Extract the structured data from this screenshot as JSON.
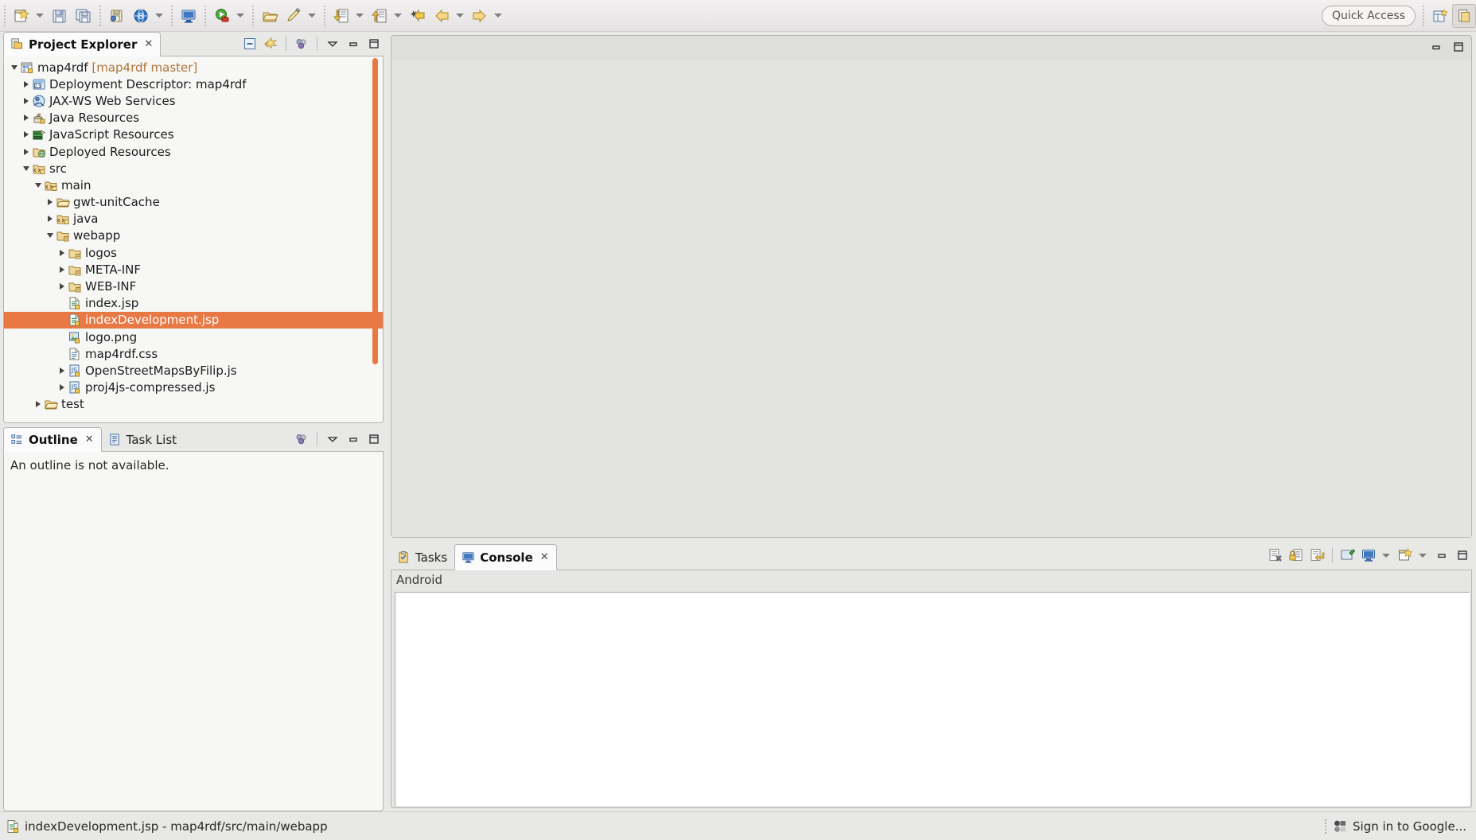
{
  "toolbar": {
    "items": [
      {
        "name": "new-wizard-button",
        "icon": "new-file-icon",
        "dropdown": true
      },
      {
        "name": "save-button",
        "icon": "save-icon",
        "dropdown": false
      },
      {
        "name": "save-all-button",
        "icon": "save-all-icon",
        "dropdown": false
      },
      {
        "name": "publish-button",
        "icon": "publish-icon",
        "dropdown": false
      },
      {
        "name": "open-browser-button",
        "icon": "globe-icon",
        "dropdown": true
      },
      {
        "name": "new-console-button",
        "icon": "console-icon",
        "dropdown": false
      },
      {
        "name": "run-button",
        "icon": "run-icon",
        "dropdown": true
      },
      {
        "name": "open-type-button",
        "icon": "open-package-icon",
        "dropdown": false
      },
      {
        "name": "search-button",
        "icon": "pencil-icon",
        "dropdown": true
      },
      {
        "name": "next-annotation-button",
        "icon": "next-annotation-icon",
        "dropdown": true
      },
      {
        "name": "previous-annotation-button",
        "icon": "previous-annotation-icon",
        "dropdown": true
      },
      {
        "name": "last-edit-location-button",
        "icon": "last-edit-icon",
        "dropdown": false
      },
      {
        "name": "back-button",
        "icon": "arrow-left-icon",
        "dropdown": true
      },
      {
        "name": "forward-button",
        "icon": "arrow-right-icon",
        "dropdown": true
      }
    ],
    "quick_access_label": "Quick Access",
    "perspective_java_ee": "open-perspective-icon",
    "perspective_current": "java-ee-perspective-icon"
  },
  "project_explorer": {
    "tab_label": "Project Explorer",
    "close_glyph": "✕",
    "tools": [
      {
        "name": "collapse-all-button",
        "icon": "collapse-all-icon"
      },
      {
        "name": "link-with-editor-button",
        "icon": "link-editor-icon"
      },
      {
        "name": "view-menu-button",
        "icon": "view-menu-icon"
      },
      {
        "name": "minimize-button",
        "icon": "minimize-icon"
      },
      {
        "name": "maximize-button",
        "icon": "maximize-icon"
      }
    ],
    "tree": [
      {
        "label": "map4rdf",
        "suffix": " [map4rdf master]",
        "indent": 0,
        "twisty": "down",
        "icon": "project-icon",
        "selected": false
      },
      {
        "label": "Deployment Descriptor: map4rdf",
        "suffix": "",
        "indent": 1,
        "twisty": "right",
        "icon": "deployment-descriptor-icon",
        "selected": false
      },
      {
        "label": "JAX-WS Web Services",
        "suffix": "",
        "indent": 1,
        "twisty": "right",
        "icon": "jaxws-icon",
        "selected": false
      },
      {
        "label": "Java Resources",
        "suffix": "",
        "indent": 1,
        "twisty": "right",
        "icon": "java-resources-icon",
        "selected": false
      },
      {
        "label": "JavaScript Resources",
        "suffix": "",
        "indent": 1,
        "twisty": "right",
        "icon": "javascript-resources-icon",
        "selected": false
      },
      {
        "label": "Deployed Resources",
        "suffix": "",
        "indent": 1,
        "twisty": "right",
        "icon": "deployed-resources-icon",
        "selected": false
      },
      {
        "label": "src",
        "suffix": "",
        "indent": 1,
        "twisty": "down",
        "icon": "source-folder-icon",
        "selected": false
      },
      {
        "label": "main",
        "suffix": "",
        "indent": 2,
        "twisty": "down",
        "icon": "source-folder-icon",
        "selected": false
      },
      {
        "label": "gwt-unitCache",
        "suffix": "",
        "indent": 3,
        "twisty": "right",
        "icon": "plain-folder-icon",
        "selected": false
      },
      {
        "label": "java",
        "suffix": "",
        "indent": 3,
        "twisty": "right",
        "icon": "source-folder-icon",
        "selected": false
      },
      {
        "label": "webapp",
        "suffix": "",
        "indent": 3,
        "twisty": "down",
        "icon": "web-folder-icon",
        "selected": false
      },
      {
        "label": "logos",
        "suffix": "",
        "indent": 4,
        "twisty": "right",
        "icon": "web-folder-icon",
        "selected": false
      },
      {
        "label": "META-INF",
        "suffix": "",
        "indent": 4,
        "twisty": "right",
        "icon": "web-folder-icon",
        "selected": false
      },
      {
        "label": "WEB-INF",
        "suffix": "",
        "indent": 4,
        "twisty": "right",
        "icon": "web-folder-icon",
        "selected": false
      },
      {
        "label": "index.jsp",
        "suffix": "",
        "indent": 4,
        "twisty": "none",
        "icon": "jsp-file-icon",
        "selected": false
      },
      {
        "label": "indexDevelopment.jsp",
        "suffix": "",
        "indent": 4,
        "twisty": "none",
        "icon": "jsp-file-icon",
        "selected": true
      },
      {
        "label": "logo.png",
        "suffix": "",
        "indent": 4,
        "twisty": "none",
        "icon": "image-file-icon",
        "selected": false
      },
      {
        "label": "map4rdf.css",
        "suffix": "",
        "indent": 4,
        "twisty": "none",
        "icon": "css-file-icon",
        "selected": false
      },
      {
        "label": "OpenStreetMapsByFilip.js",
        "suffix": "",
        "indent": 4,
        "twisty": "right",
        "icon": "js-file-icon",
        "selected": false
      },
      {
        "label": "proj4js-compressed.js",
        "suffix": "",
        "indent": 4,
        "twisty": "right",
        "icon": "js-file-icon",
        "selected": false
      },
      {
        "label": "test",
        "suffix": "",
        "indent": 2,
        "twisty": "right",
        "icon": "plain-folder-icon",
        "selected": false
      }
    ]
  },
  "outline": {
    "tabs": [
      {
        "label": "Outline",
        "icon": "outline-icon",
        "active": true,
        "closeable": true
      },
      {
        "label": "Task List",
        "icon": "task-list-icon",
        "active": false,
        "closeable": false
      }
    ],
    "close_glyph": "✕",
    "message": "An outline is not available.",
    "tools": [
      {
        "name": "view-menu-button",
        "icon": "view-menu-icon"
      },
      {
        "name": "minimize-button",
        "icon": "minimize-icon"
      },
      {
        "name": "maximize-button",
        "icon": "maximize-icon"
      }
    ]
  },
  "editor": {
    "tools": [
      {
        "name": "minimize-button",
        "icon": "minimize-icon"
      },
      {
        "name": "maximize-button",
        "icon": "maximize-icon"
      }
    ]
  },
  "console": {
    "tabs": [
      {
        "label": "Tasks",
        "icon": "tasks-icon",
        "active": false,
        "closeable": false
      },
      {
        "label": "Console",
        "icon": "console-icon",
        "active": true,
        "closeable": true
      }
    ],
    "close_glyph": "✕",
    "header_label": "Android",
    "output": "",
    "tools": [
      {
        "name": "clear-console-button",
        "icon": "clear-console-icon"
      },
      {
        "name": "scroll-lock-button",
        "icon": "scroll-lock-icon"
      },
      {
        "name": "word-wrap-button",
        "icon": "word-wrap-icon"
      },
      {
        "name": "pin-console-button",
        "icon": "pin-console-icon"
      },
      {
        "name": "display-selected-console-button",
        "icon": "display-console-icon",
        "dropdown": true
      },
      {
        "name": "open-console-button",
        "icon": "open-console-icon",
        "dropdown": true
      },
      {
        "name": "minimize-button",
        "icon": "minimize-icon"
      },
      {
        "name": "maximize-button",
        "icon": "maximize-icon"
      }
    ]
  },
  "statusbar": {
    "selection_icon": "jsp-file-icon",
    "selection_text": "indexDevelopment.jsp - map4rdf/src/main/webapp",
    "google_icon": "google-signin-icon",
    "google_label": "Sign in to Google..."
  },
  "colors": {
    "selection_orange": "#e87844",
    "project_suffix": "#b0753a",
    "panel_bg": "#e8e8e7",
    "view_bg": "#f7f7f6",
    "console_white": "#ffffff"
  }
}
